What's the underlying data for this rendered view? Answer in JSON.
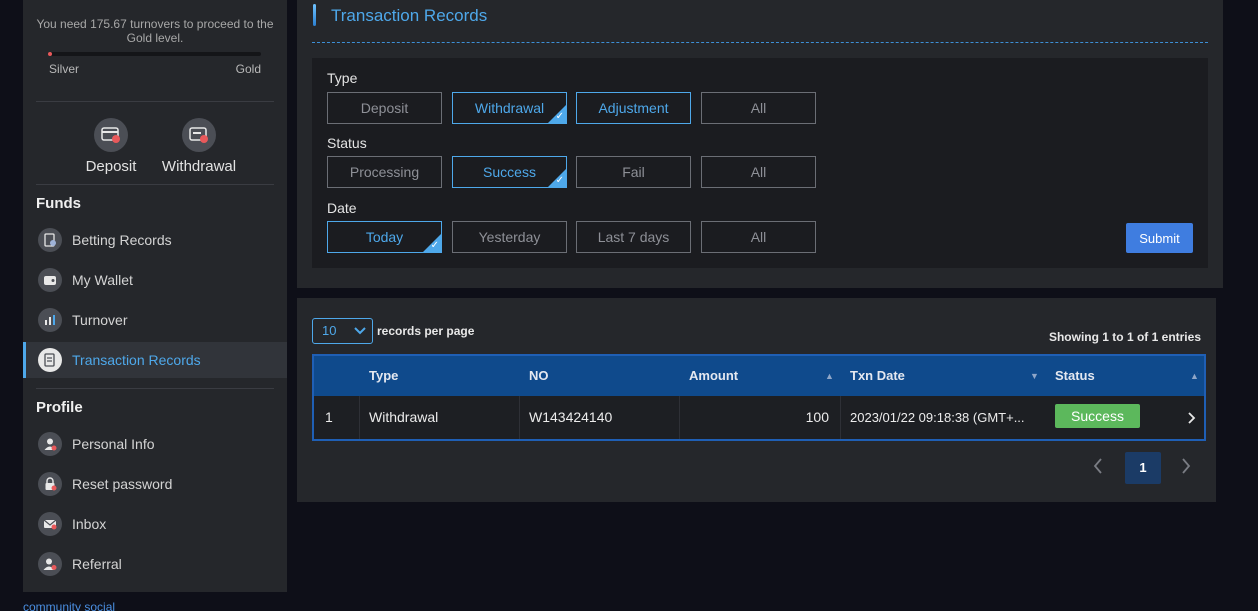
{
  "sidebar": {
    "vip_message": "You need 175.67 turnovers to proceed to the Gold level.",
    "progress": 0.01,
    "level_from": "Silver",
    "level_to": "Gold",
    "quick_actions": [
      {
        "label": "Deposit",
        "icon": "deposit-icon"
      },
      {
        "label": "Withdrawal",
        "icon": "withdrawal-icon"
      }
    ],
    "funds_title": "Funds",
    "funds_items": [
      {
        "label": "Betting Records",
        "icon": "betting-records-icon"
      },
      {
        "label": "My Wallet",
        "icon": "wallet-icon"
      },
      {
        "label": "Turnover",
        "icon": "turnover-icon"
      },
      {
        "label": "Transaction Records",
        "icon": "transaction-records-icon",
        "active": true
      }
    ],
    "profile_title": "Profile",
    "profile_items": [
      {
        "label": "Personal Info",
        "icon": "personal-info-icon"
      },
      {
        "label": "Reset password",
        "icon": "lock-icon"
      },
      {
        "label": "Inbox",
        "icon": "mail-icon"
      },
      {
        "label": "Referral",
        "icon": "referral-icon"
      }
    ],
    "community_label": "community social"
  },
  "filters": {
    "title": "Transaction Records",
    "type_label": "Type",
    "type_options": [
      "Deposit",
      "Withdrawal",
      "Adjustment",
      "All"
    ],
    "type_selected": "Withdrawal",
    "status_label": "Status",
    "status_options": [
      "Processing",
      "Success",
      "Fail",
      "All"
    ],
    "status_selected": "Success",
    "date_label": "Date",
    "date_options": [
      "Today",
      "Yesterday",
      "Last 7 days",
      "All"
    ],
    "date_selected": "Today",
    "submit_label": "Submit"
  },
  "table": {
    "per_page_value": "10",
    "per_page_label": "records per page",
    "showing_text": "Showing 1 to 1 of 1 entries",
    "columns": [
      "",
      "Type",
      "NO",
      "Amount",
      "Txn Date",
      "Status"
    ],
    "rows": [
      {
        "index": "1",
        "type": "Withdrawal",
        "no": "W143424140",
        "amount": "100",
        "txn_date": "2023/01/22 09:18:38 (GMT+...",
        "status": "Success"
      }
    ],
    "current_page": "1"
  },
  "colors": {
    "accent": "#4ea8ea",
    "header_blue": "#0f4a8c",
    "success": "#5cb85c",
    "submit": "#3f7de0"
  }
}
